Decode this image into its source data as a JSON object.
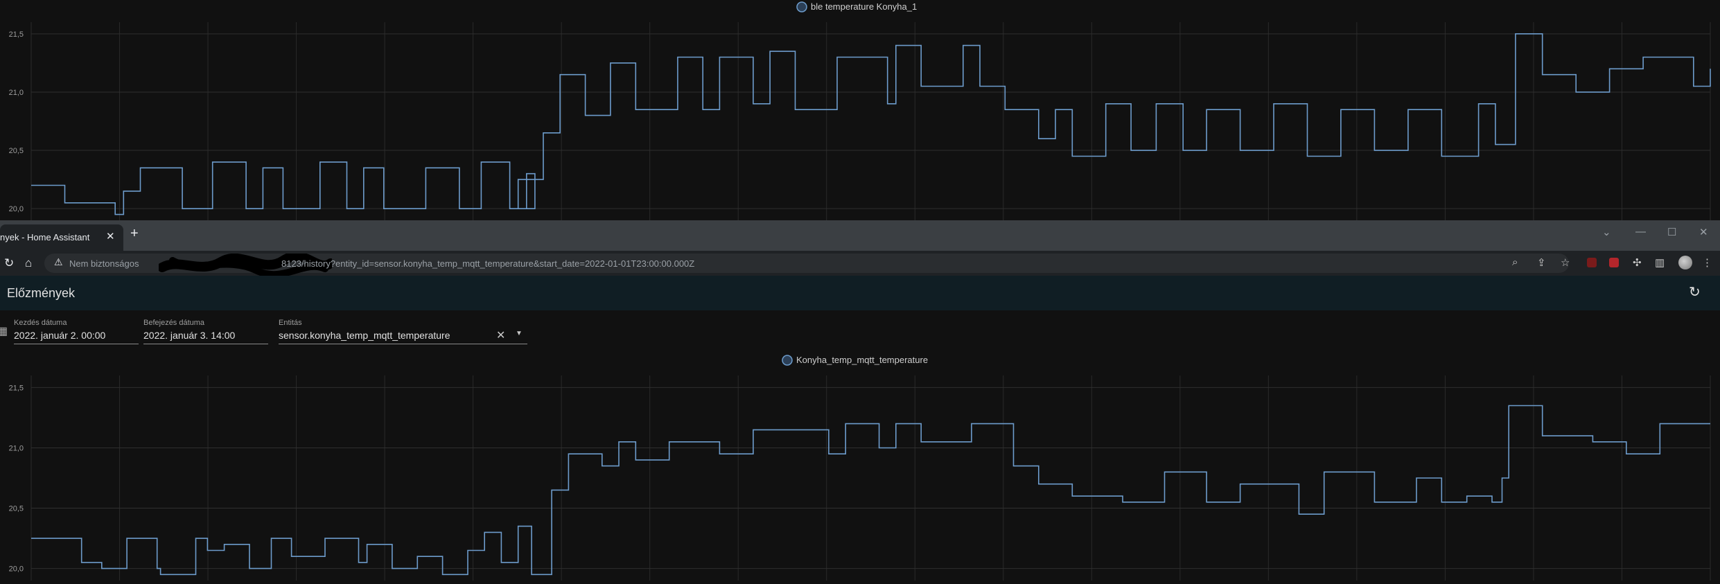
{
  "top_chart": {
    "legend": "ble temperature Konyha_1",
    "y_ticks": [
      "21,5",
      "21,0",
      "20,5",
      "20,0"
    ],
    "ylim": [
      19.9,
      21.6
    ],
    "series_color": "#6d9ccc"
  },
  "browser": {
    "tab_title": "nyek - Home Assistant",
    "close_icon": "close-icon",
    "new_tab_icon": "plus-icon",
    "security_text": "Nem biztonságos",
    "url_tail": "8123/history?entity_id=sensor.konyha_temp_mqtt_temperature&start_date=2022-01-01T23:00:00.000Z"
  },
  "ha": {
    "title": "Előzmények",
    "start_label": "Kezdés dátuma",
    "start_value": "2022. január 2. 00:00",
    "end_label": "Befejezés dátuma",
    "end_value": "2022. január 3. 14:00",
    "entity_label": "Entitás",
    "entity_value": "sensor.konyha_temp_mqtt_temperature"
  },
  "bottom_chart": {
    "legend": "Konyha_temp_mqtt_temperature",
    "y_ticks": [
      "21,5",
      "21,0",
      "20,5",
      "20,0"
    ],
    "ylim": [
      19.9,
      21.6
    ],
    "series_color": "#6d9ccc"
  },
  "chart_data": [
    {
      "type": "line",
      "legend": "ble temperature Konyha_1",
      "y_ticks": [
        "21,5",
        "21,0",
        "20,5",
        "20,0"
      ],
      "ylim": [
        19.9,
        21.6
      ],
      "x_fraction": [
        0.0,
        0.02,
        0.05,
        0.055,
        0.065,
        0.09,
        0.108,
        0.128,
        0.138,
        0.15,
        0.172,
        0.188,
        0.198,
        0.21,
        0.235,
        0.255,
        0.268,
        0.285,
        0.295,
        0.3,
        0.29,
        0.305,
        0.315,
        0.33,
        0.345,
        0.36,
        0.385,
        0.4,
        0.41,
        0.43,
        0.44,
        0.455,
        0.48,
        0.51,
        0.515,
        0.53,
        0.555,
        0.565,
        0.58,
        0.6,
        0.61,
        0.62,
        0.64,
        0.655,
        0.67,
        0.686,
        0.7,
        0.72,
        0.74,
        0.76,
        0.78,
        0.8,
        0.82,
        0.84,
        0.862,
        0.872,
        0.884,
        0.9,
        0.92,
        0.94,
        0.96,
        0.99,
        1.0
      ],
      "values": [
        20.2,
        20.05,
        19.95,
        20.15,
        20.35,
        20.0,
        20.4,
        20.0,
        20.35,
        20.0,
        20.4,
        20.0,
        20.35,
        20.0,
        20.35,
        20.0,
        20.4,
        20.0,
        20.3,
        20.0,
        20.25,
        20.65,
        21.15,
        20.8,
        21.25,
        20.85,
        21.3,
        20.85,
        21.3,
        20.9,
        21.35,
        20.85,
        21.3,
        20.9,
        21.4,
        21.05,
        21.4,
        21.05,
        20.85,
        20.6,
        20.85,
        20.45,
        20.9,
        20.5,
        20.9,
        20.5,
        20.85,
        20.5,
        20.9,
        20.45,
        20.85,
        20.5,
        20.85,
        20.45,
        20.9,
        20.55,
        21.5,
        21.15,
        21.0,
        21.2,
        21.3,
        21.05,
        21.2
      ]
    },
    {
      "type": "line",
      "legend": "Konyha_temp_mqtt_temperature",
      "y_ticks": [
        "21,5",
        "21,0",
        "20,5",
        "20,0"
      ],
      "ylim": [
        19.9,
        21.6
      ],
      "x_fraction": [
        0.0,
        0.03,
        0.042,
        0.057,
        0.075,
        0.077,
        0.098,
        0.105,
        0.115,
        0.13,
        0.143,
        0.155,
        0.175,
        0.195,
        0.2,
        0.215,
        0.23,
        0.245,
        0.26,
        0.27,
        0.28,
        0.29,
        0.298,
        0.31,
        0.32,
        0.34,
        0.35,
        0.36,
        0.38,
        0.41,
        0.43,
        0.46,
        0.475,
        0.485,
        0.505,
        0.515,
        0.53,
        0.56,
        0.585,
        0.6,
        0.62,
        0.65,
        0.675,
        0.7,
        0.72,
        0.755,
        0.77,
        0.8,
        0.825,
        0.84,
        0.855,
        0.87,
        0.876,
        0.88,
        0.9,
        0.93,
        0.95,
        0.97,
        1.0
      ],
      "values": [
        20.25,
        20.05,
        20.0,
        20.25,
        20.0,
        19.95,
        20.25,
        20.15,
        20.2,
        20.0,
        20.25,
        20.1,
        20.25,
        20.05,
        20.2,
        20.0,
        20.1,
        19.95,
        20.15,
        20.3,
        20.05,
        20.35,
        19.95,
        20.65,
        20.95,
        20.85,
        21.05,
        20.9,
        21.05,
        20.95,
        21.15,
        21.15,
        20.95,
        21.2,
        21.0,
        21.2,
        21.05,
        21.2,
        20.85,
        20.7,
        20.6,
        20.55,
        20.8,
        20.55,
        20.7,
        20.45,
        20.8,
        20.55,
        20.75,
        20.55,
        20.6,
        20.55,
        20.75,
        21.35,
        21.1,
        21.05,
        20.95,
        21.2,
        21.2
      ]
    }
  ]
}
